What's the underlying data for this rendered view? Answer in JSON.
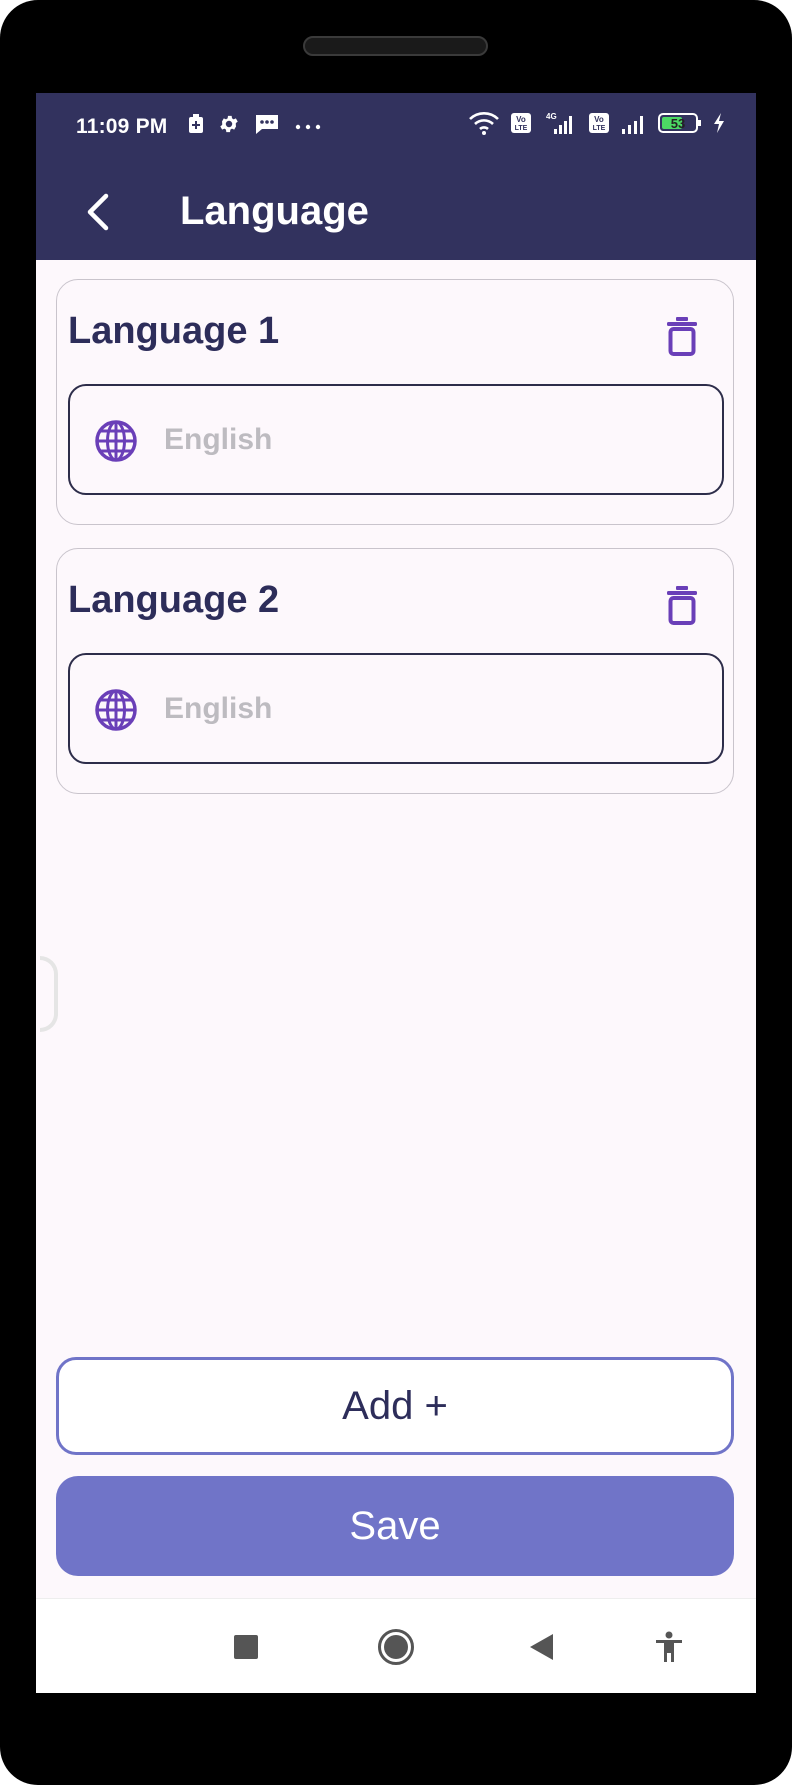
{
  "status_bar": {
    "time": "11:09 PM",
    "battery_level": "53",
    "icons": [
      "battery-saver-icon",
      "settings-icon",
      "message-icon",
      "more-dots-icon",
      "wifi-icon",
      "volte-icon",
      "signal-4g-icon",
      "volte-icon",
      "signal-icon",
      "battery-icon",
      "charging-icon"
    ]
  },
  "app_bar": {
    "title": "Language",
    "back_icon": "chevron-left-icon"
  },
  "languages": [
    {
      "title": "Language 1",
      "placeholder": "English",
      "value": ""
    },
    {
      "title": "Language 2",
      "placeholder": "English",
      "value": ""
    }
  ],
  "buttons": {
    "add_label": "Add +",
    "save_label": "Save"
  },
  "nav_bar": {
    "icons": [
      "recents-square-icon",
      "home-circle-icon",
      "back-triangle-icon",
      "accessibility-icon"
    ]
  },
  "colors": {
    "app_bar": "#32325e",
    "accent_purple": "#6a3fb8",
    "primary_button": "#7074c8",
    "screen_bg": "#fdf8fc",
    "text_dark": "#2d2d5a",
    "placeholder": "#bdbbc0"
  }
}
